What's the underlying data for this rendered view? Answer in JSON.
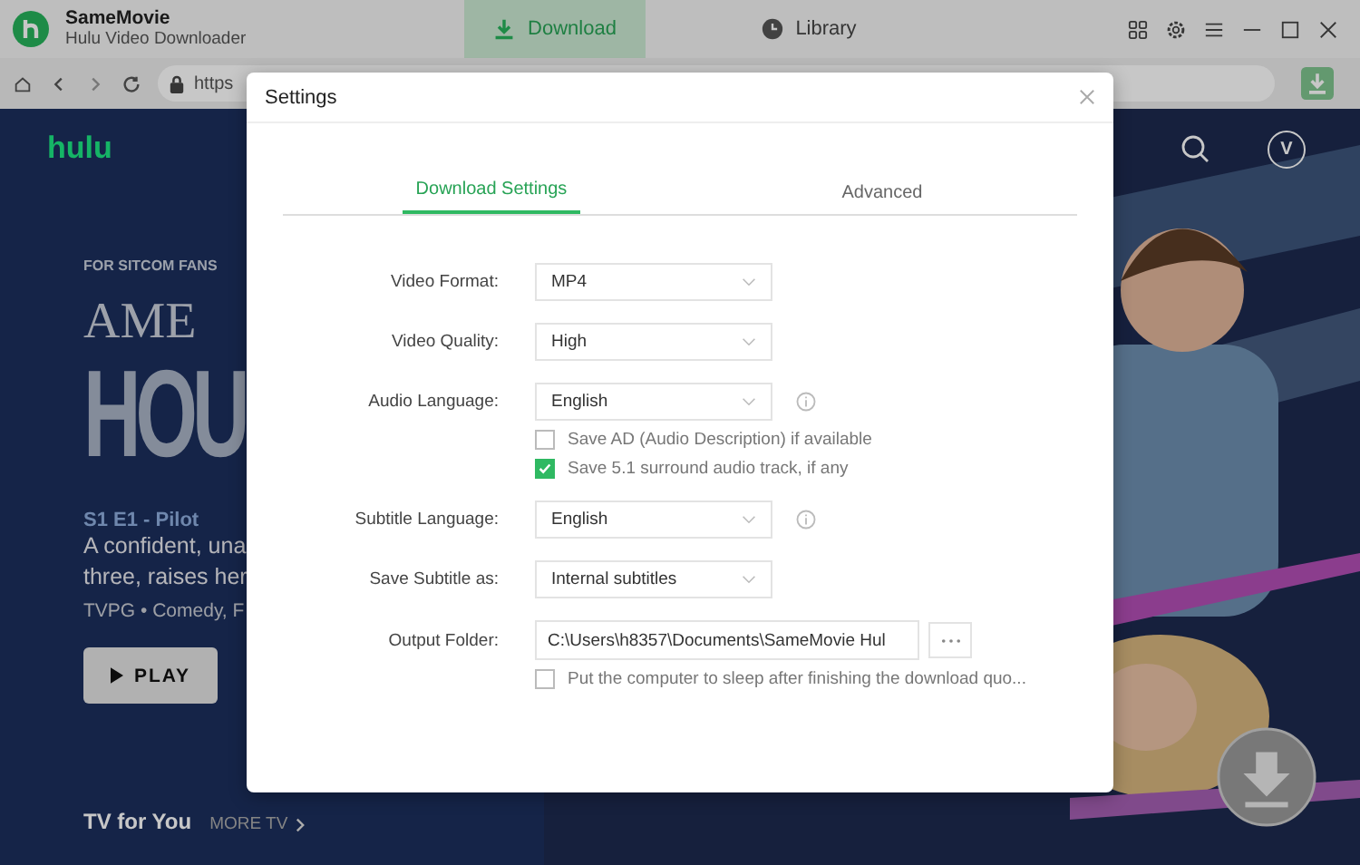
{
  "window": {
    "app_name": "SameMovie",
    "app_subtitle": "Hulu Video Downloader"
  },
  "nav_tabs": [
    {
      "label": "Download",
      "selected": true,
      "kind": "download"
    },
    {
      "label": "Library",
      "selected": false,
      "kind": "clock"
    }
  ],
  "address_bar": {
    "url": "https"
  },
  "hero": {
    "logo": "hulu",
    "eyebrow": "FOR SITCOM FANS",
    "title_lines": [
      "AME",
      "HOU"
    ],
    "episode": "S1 E1 - Pilot",
    "description_lines": [
      "A confident, una",
      "three, raises her"
    ],
    "meta": "TVPG • Comedy, F",
    "play": "PLAY",
    "avatar": "V",
    "row_title": "TV for You",
    "more": "MORE TV"
  },
  "settings": {
    "title": "Settings",
    "tabs": [
      {
        "label": "Download Settings",
        "selected": true
      },
      {
        "label": "Advanced",
        "selected": false
      }
    ],
    "rows": [
      {
        "kind": "select",
        "label": "Video Format:",
        "value": "MP4",
        "info": false
      },
      {
        "kind": "select",
        "label": "Video Quality:",
        "value": "High",
        "info": false
      },
      {
        "kind": "select",
        "label": "Audio Language:",
        "value": "English",
        "info": true
      },
      {
        "kind": "checkbox",
        "label": "Save AD (Audio Description) if available",
        "checked": false
      },
      {
        "kind": "checkbox",
        "label": "Save 5.1 surround audio track, if any",
        "checked": true
      },
      {
        "kind": "select",
        "label": "Subtitle Language:",
        "value": "English",
        "info": true
      },
      {
        "kind": "select",
        "label": "Save Subtitle as:",
        "value": "Internal subtitles",
        "info": false
      },
      {
        "kind": "folder",
        "label": "Output Folder:",
        "value": "C:\\Users\\h8357\\Documents\\SameMovie Hul"
      },
      {
        "kind": "checkbox",
        "label": "Put the computer to sleep after finishing the download quo...",
        "checked": false
      }
    ]
  }
}
